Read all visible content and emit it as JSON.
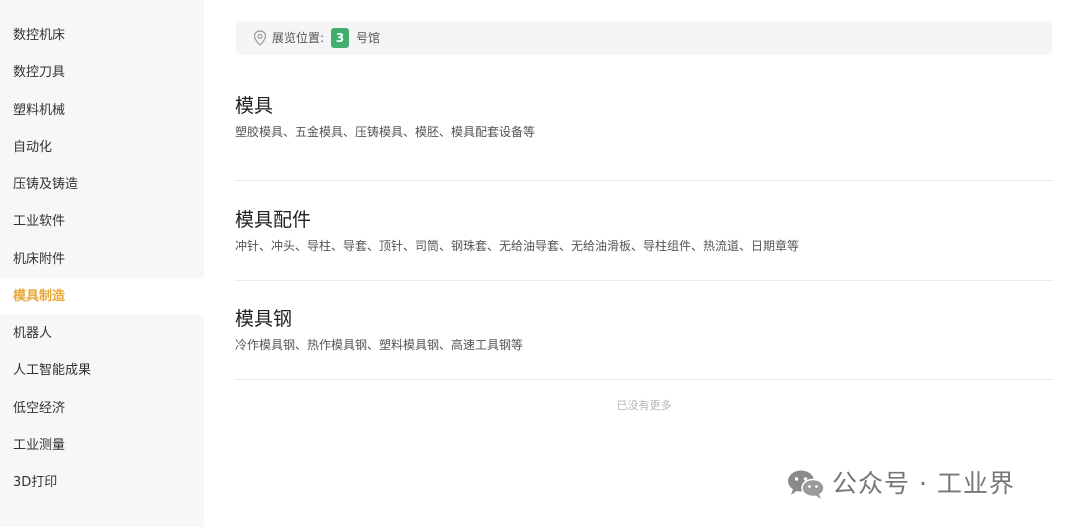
{
  "sidebar": {
    "items": [
      {
        "label": "数控机床"
      },
      {
        "label": "数控刀具"
      },
      {
        "label": "塑料机械"
      },
      {
        "label": "自动化"
      },
      {
        "label": "压铸及铸造"
      },
      {
        "label": "工业软件"
      },
      {
        "label": "机床附件"
      },
      {
        "label": "模具制造",
        "active": true
      },
      {
        "label": "机器人"
      },
      {
        "label": "人工智能成果"
      },
      {
        "label": "低空经济"
      },
      {
        "label": "工业测量"
      },
      {
        "label": "3D打印"
      }
    ],
    "active_color": "#e8a93a"
  },
  "location": {
    "label": "展览位置:",
    "hall_number": "3",
    "hall_suffix": "号馆",
    "icon": "location-pin-icon",
    "badge_color": "#3fae6e"
  },
  "categories": [
    {
      "title": "模具",
      "description": "塑胶模具、五金模具、压铸模具、模胚、模具配套设备等"
    },
    {
      "title": "模具配件",
      "description": "冲针、冲头、导柱、导套、顶针、司筒、钢珠套、无给油导套、无给油滑板、导柱组件、热流道、日期章等"
    },
    {
      "title": "模具钢",
      "description": "冷作模具钢、热作模具钢、塑料模具钢、高速工具钢等"
    }
  ],
  "footer": {
    "no_more": "已没有更多"
  },
  "watermark": {
    "text": "公众号 · 工业界",
    "icon": "wechat-icon"
  }
}
